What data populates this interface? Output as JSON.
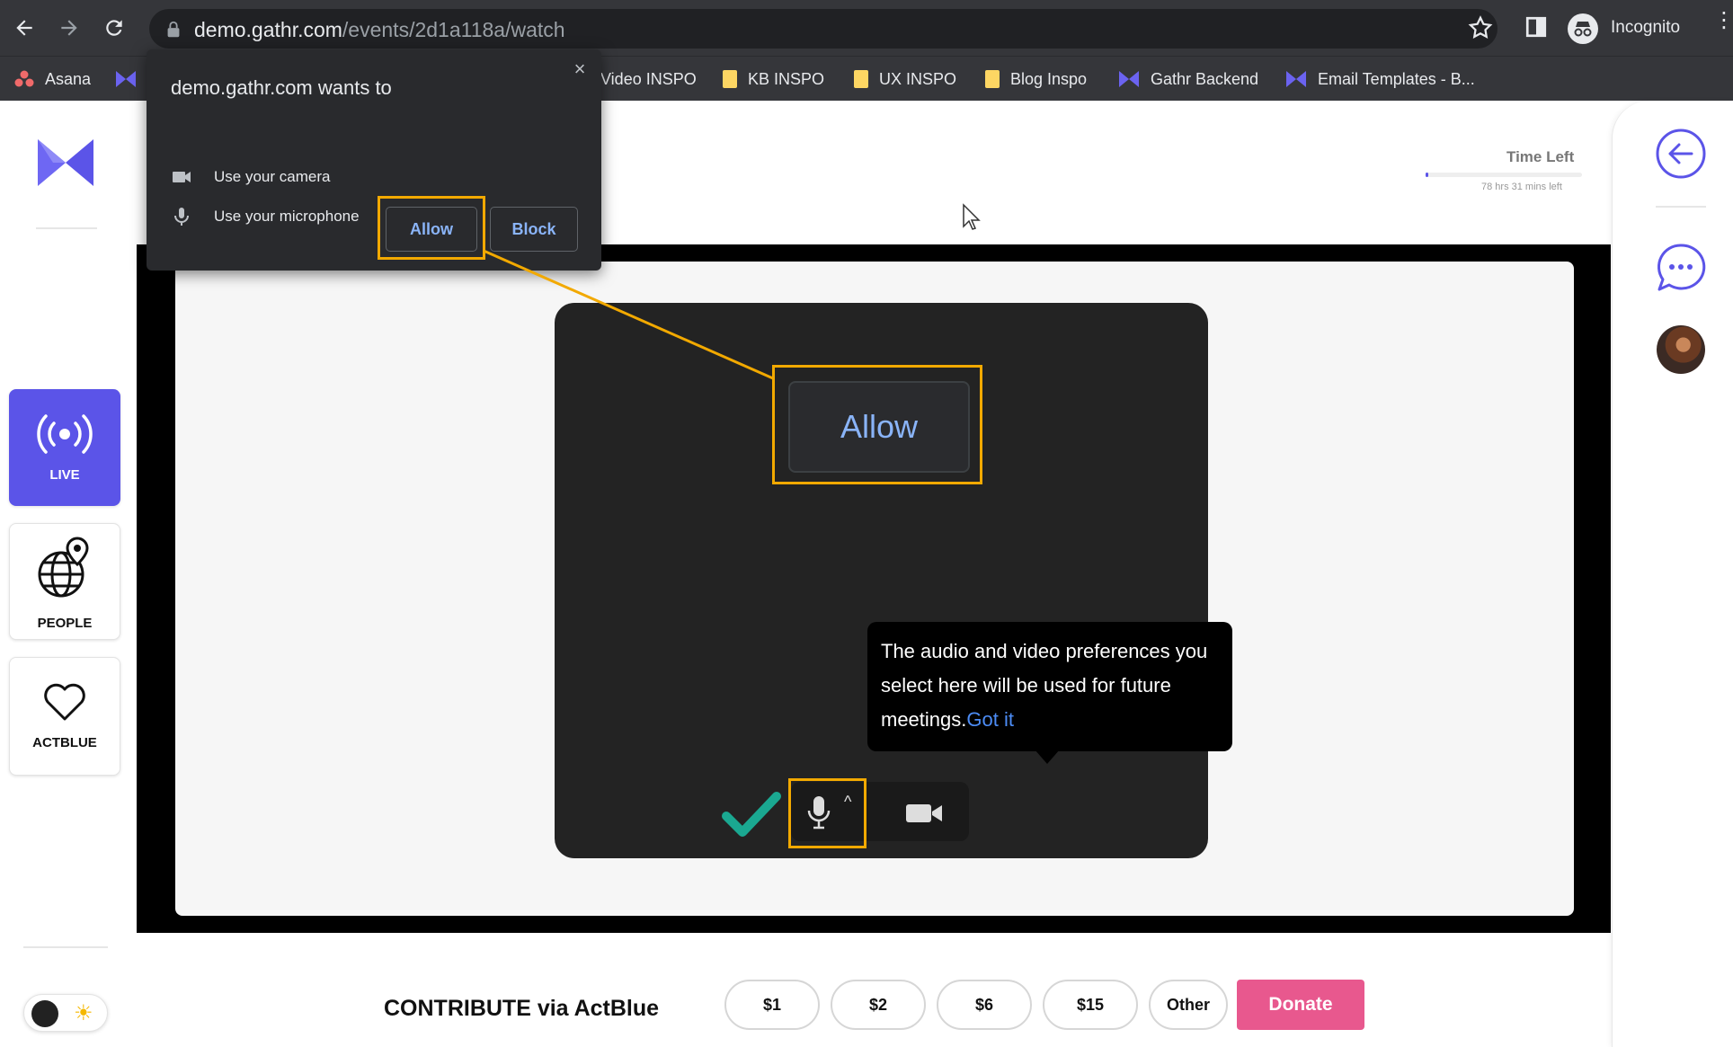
{
  "browser": {
    "url_host": "demo.gathr.com",
    "url_path": "/events/2d1a118a/watch",
    "profile_label": "Incognito",
    "bookmarks": [
      {
        "label": "Asana",
        "icon": "asana-icon"
      },
      {
        "label": "",
        "icon": "gathr-logo-icon"
      },
      {
        "label": "Video INSPO",
        "icon": "folder-icon"
      },
      {
        "label": "KB INSPO",
        "icon": "folder-icon"
      },
      {
        "label": "UX INSPO",
        "icon": "folder-icon"
      },
      {
        "label": "Blog Inspo",
        "icon": "folder-icon"
      },
      {
        "label": "Gathr Backend",
        "icon": "gathr-logo-icon"
      },
      {
        "label": "Email Templates - B...",
        "icon": "gathr-logo-icon"
      }
    ]
  },
  "permission_prompt": {
    "title": "demo.gathr.com wants to",
    "camera": "Use your camera",
    "microphone": "Use your microphone",
    "allow": "Allow",
    "block": "Block",
    "close": "×"
  },
  "left_rail": {
    "items": [
      {
        "label": "LIVE",
        "icon": "live-broadcast-icon",
        "active": true
      },
      {
        "label": "PEOPLE",
        "icon": "globe-pin-icon",
        "active": false
      },
      {
        "label": "ACTBLUE",
        "icon": "heart-icon",
        "active": false
      }
    ],
    "theme_toggle": {
      "icon": "sun-icon"
    }
  },
  "header": {
    "time_left_label": "Time Left",
    "time_left_sub": "78 hrs 31 mins left",
    "time_left_fraction": 0.02
  },
  "preview": {
    "allow_zoom_label": "Allow",
    "tooltip_text": "The audio and video preferences you select here will be used for future meetings.",
    "tooltip_link": "Got it",
    "mic_caret": "^"
  },
  "contribute": {
    "label": "CONTRIBUTE via ActBlue",
    "amounts": [
      "$1",
      "$2",
      "$6",
      "$15",
      "Other"
    ],
    "donate": "Donate"
  },
  "colors": {
    "brand": "#5b54e8",
    "highlight": "#f2a900",
    "donate": "#e8588e",
    "link": "#4c8cf5"
  }
}
